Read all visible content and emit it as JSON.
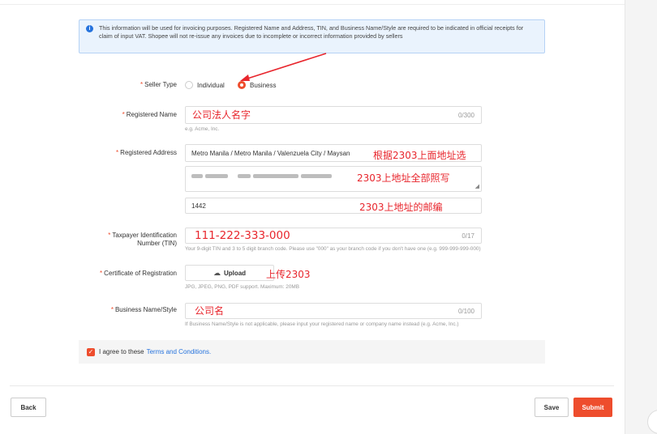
{
  "info_text": "This information will be used for invoicing purposes. Registered Name and Address, TIN, and Business Name/Style are required to be indicated in official receipts for claim of input VAT. Shopee will not re-issue any invoices due to incomplete or incorrect information provided by sellers",
  "seller_type": {
    "label": "Seller Type",
    "options": [
      "Individual",
      "Business"
    ],
    "selected": "Business"
  },
  "registered_name": {
    "label": "Registered Name",
    "counter": "0/300",
    "hint": "e.g. Acme, Inc.",
    "annotation": "公司法人名字"
  },
  "registered_address": {
    "label": "Registered Address",
    "region_value": "Metro Manila / Metro Manila / Valenzuela City / Maysan",
    "region_annotation": "根据2303上面地址选",
    "detail_annotation": "2303上地址全部照写",
    "zip_value": "1442",
    "zip_annotation": "2303上地址的邮编"
  },
  "tin": {
    "label_line1": "Taxpayer Identification",
    "label_line2": "Number (TIN)",
    "counter": "0/17",
    "annotation": "111-222-333-000",
    "hint": "Your 9-digit TIN and 3 to 5 digit branch code. Please use \"000\" as your branch code if you don't have one (e.g. 999-999-999-000)"
  },
  "certificate": {
    "label": "Certificate of Registration",
    "upload_label": "Upload",
    "annotation": "上传2303",
    "hint": "JPG, JPEG, PNG, PDF support. Maximum: 20MB"
  },
  "business_name": {
    "label": "Business Name/Style",
    "counter": "0/100",
    "annotation": "公司名",
    "hint": "If Business Name/Style is not applicable, please input your registered name or company name instead (e.g. Acme, Inc.)"
  },
  "agree": {
    "text": "I agree to these",
    "link": "Terms and Conditions."
  },
  "footer": {
    "back": "Back",
    "save": "Save",
    "submit": "Submit"
  },
  "colors": {
    "accent": "#ee4d2d",
    "annotation": "#e8262d",
    "info_bg": "#eaf3fd",
    "link": "#2673dd"
  }
}
